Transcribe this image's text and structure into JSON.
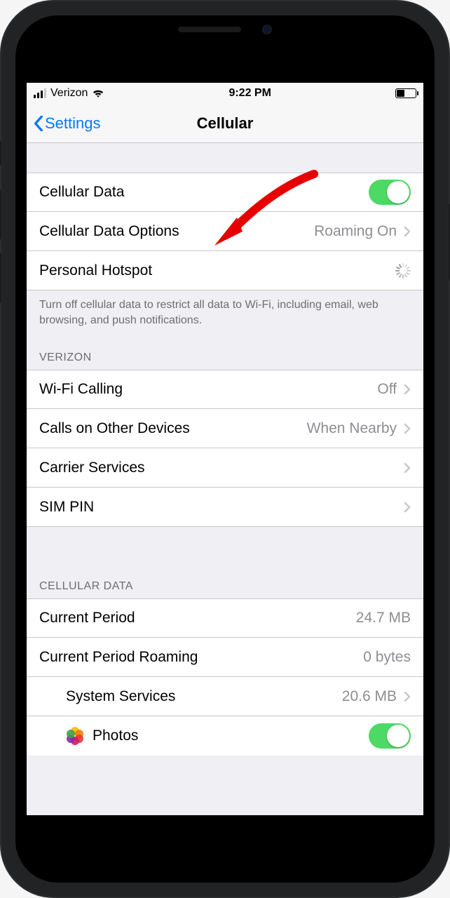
{
  "statusbar": {
    "carrier": "Verizon",
    "time": "9:22 PM"
  },
  "nav": {
    "back_label": "Settings",
    "title": "Cellular"
  },
  "group1": {
    "cellular_data": "Cellular Data",
    "options_label": "Cellular Data Options",
    "options_value": "Roaming On",
    "hotspot": "Personal Hotspot",
    "footer": "Turn off cellular data to restrict all data to Wi-Fi, including email, web browsing, and push notifications."
  },
  "group2": {
    "header": "VERIZON",
    "wifi_calling": "Wi-Fi Calling",
    "wifi_calling_value": "Off",
    "calls_other": "Calls on Other Devices",
    "calls_other_value": "When Nearby",
    "carrier_services": "Carrier Services",
    "sim_pin": "SIM PIN"
  },
  "group3": {
    "header": "CELLULAR DATA",
    "current_period": "Current Period",
    "current_period_value": "24.7 MB",
    "roaming": "Current Period Roaming",
    "roaming_value": "0 bytes",
    "system_services": "System Services",
    "system_services_value": "20.6 MB",
    "photos": "Photos"
  }
}
